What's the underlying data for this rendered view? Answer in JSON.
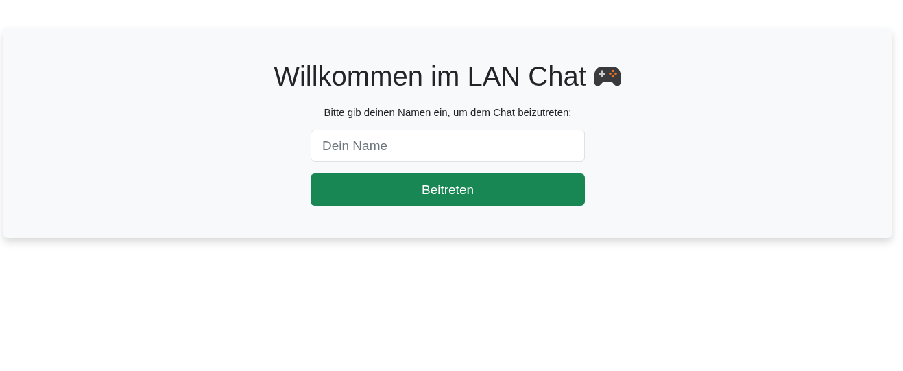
{
  "card": {
    "title": "Willkommen im LAN Chat",
    "prompt": "Bitte gib deinen Namen ein, um dem Chat beizutreten:",
    "name_field": {
      "placeholder": "Dein Name"
    },
    "join_button": "Beitreten"
  }
}
